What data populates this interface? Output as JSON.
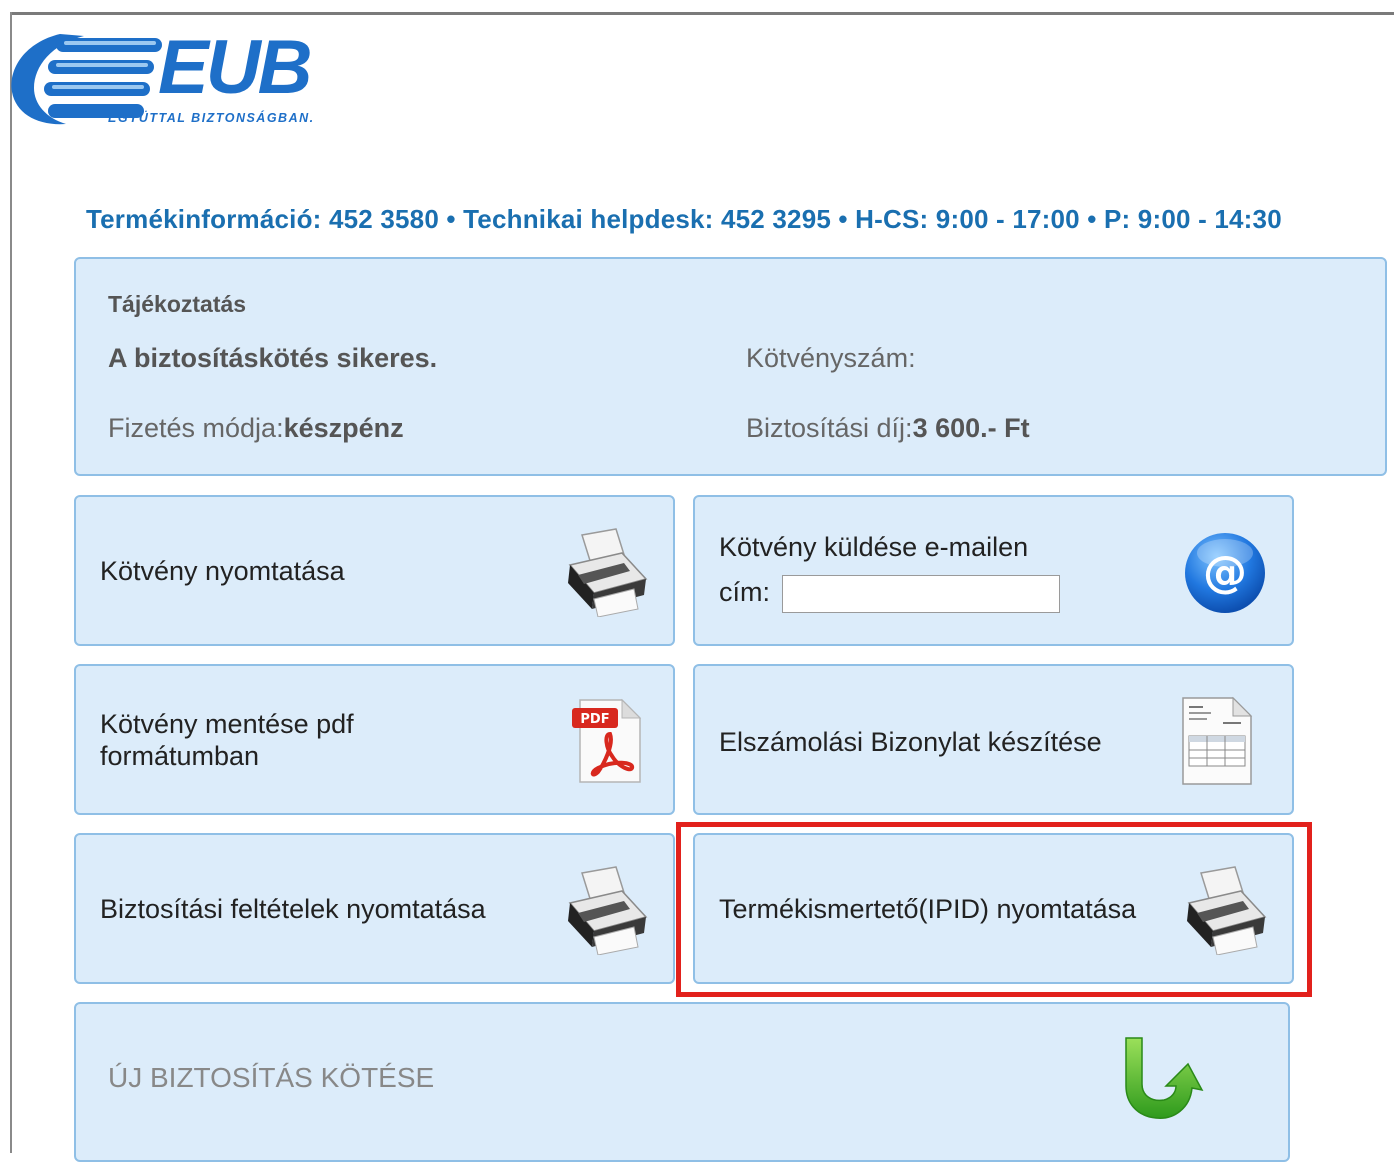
{
  "logo": {
    "brand": "EUB",
    "tagline": "EGYÜTTAL BIZTONSÁGBAN."
  },
  "infobar": "Termékinformáció: 452 3580 • Technikai helpdesk: 452 3295 • H-CS: 9:00 - 17:00 • P: 9:00 - 14:30",
  "info": {
    "title": "Tájékoztatás",
    "success": "A biztosításkötés sikeres.",
    "policy_label": "Kötvényszám:",
    "payment_label": "Fizetés módja:",
    "payment_value": "készpénz",
    "fee_label": "Biztosítási díj:",
    "fee_value": "3 600.- Ft"
  },
  "actions": {
    "print_policy": "Kötvény nyomtatása",
    "email_policy": "Kötvény küldése e-mailen",
    "email_address_label": "cím:",
    "email_address_value": "",
    "save_pdf_line1": "Kötvény mentése pdf",
    "save_pdf_line2": "formátumban",
    "settlement": "Elszámolási Bizonylat készítése",
    "print_terms": "Biztosítási feltételek nyomtatása",
    "print_ipid": "Termékismertető(IPID) nyomtatása",
    "new_insurance": "ÚJ BIZTOSÍTÁS KÖTÉSE"
  },
  "icons": {
    "printer": "printer-icon",
    "email": "at-sign-icon",
    "pdf": "pdf-icon",
    "document": "document-icon",
    "refresh": "refresh-arrow-icon"
  },
  "colors": {
    "accent": "#1a6fb0",
    "panel_bg": "#dcecfa",
    "panel_border": "#8fbfe6",
    "highlight": "#e2211c"
  }
}
